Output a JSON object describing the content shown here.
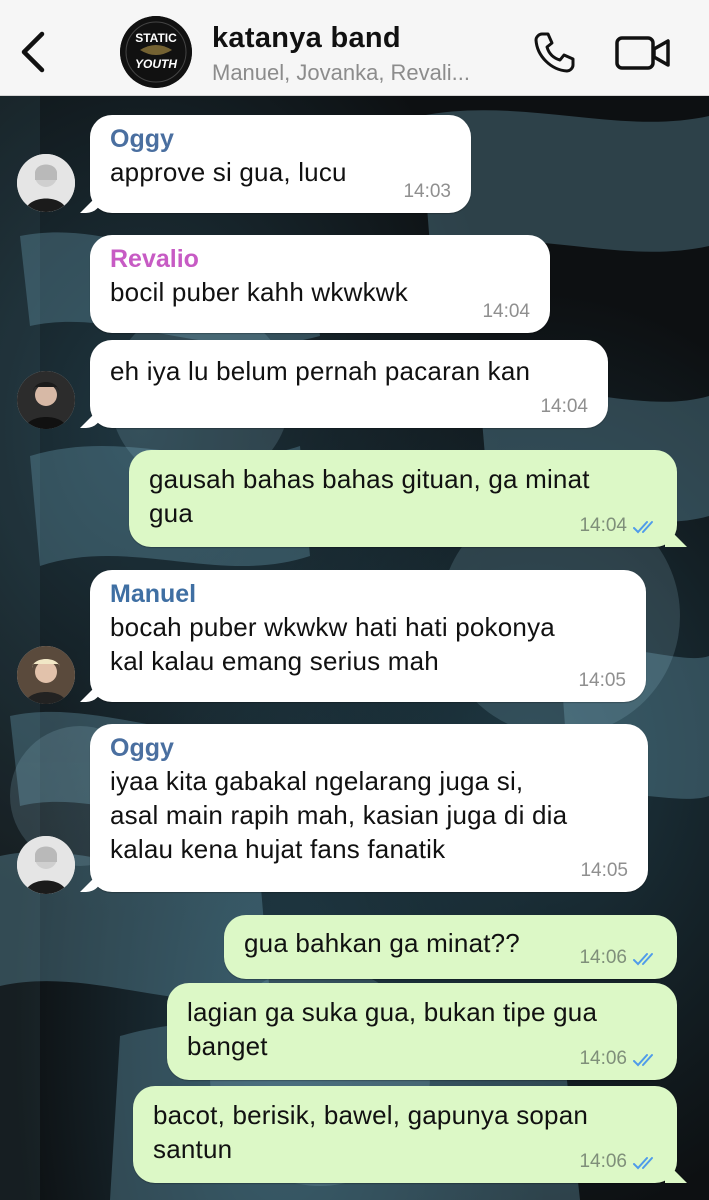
{
  "header": {
    "title": "katanya band",
    "subtitle": "Manuel, Jovanka, Revali...",
    "avatar_text_top": "STATIC",
    "avatar_text_bottom": "YOUTH",
    "back_icon": "chevron-left-icon",
    "call_icon": "phone-icon",
    "video_icon": "video-camera-icon"
  },
  "colors": {
    "oggy": "#4a6fa0",
    "revalio": "#c75bc4",
    "manuel": "#3f6fa3",
    "outgoing_bubble": "#dcf8c6",
    "incoming_bubble": "#ffffff",
    "read_ticks": "#4f9bea"
  },
  "messages": [
    {
      "sender": "Oggy",
      "text": "approve si gua, lucu",
      "time": "14:03"
    },
    {
      "sender": "Revalio",
      "text": "bocil puber kahh wkwkwk",
      "time": "14:04"
    },
    {
      "sender": "",
      "text": "eh iya lu belum pernah pacaran kan",
      "time": "14:04"
    },
    {
      "sender": "",
      "line1": "gausah bahas bahas gituan, ga minat",
      "line2": "gua",
      "time": "14:04"
    },
    {
      "sender": "Manuel",
      "line1": "bocah puber wkwkw hati hati pokonya",
      "line2": "kal kalau emang serius mah",
      "time": "14:05"
    },
    {
      "sender": "Oggy",
      "line1": "iyaa kita gabakal ngelarang juga si,",
      "line2": "asal main rapih mah, kasian juga di dia",
      "line3": "kalau kena hujat fans fanatik",
      "time": "14:05"
    },
    {
      "sender": "",
      "text": "gua bahkan ga minat??",
      "time": "14:06"
    },
    {
      "sender": "",
      "line1": "lagian ga suka gua, bukan tipe gua",
      "line2": "banget",
      "time": "14:06"
    },
    {
      "sender": "",
      "line1": "bacot, berisik, bawel, gapunya sopan",
      "line2": "santun",
      "time": "14:06"
    }
  ]
}
